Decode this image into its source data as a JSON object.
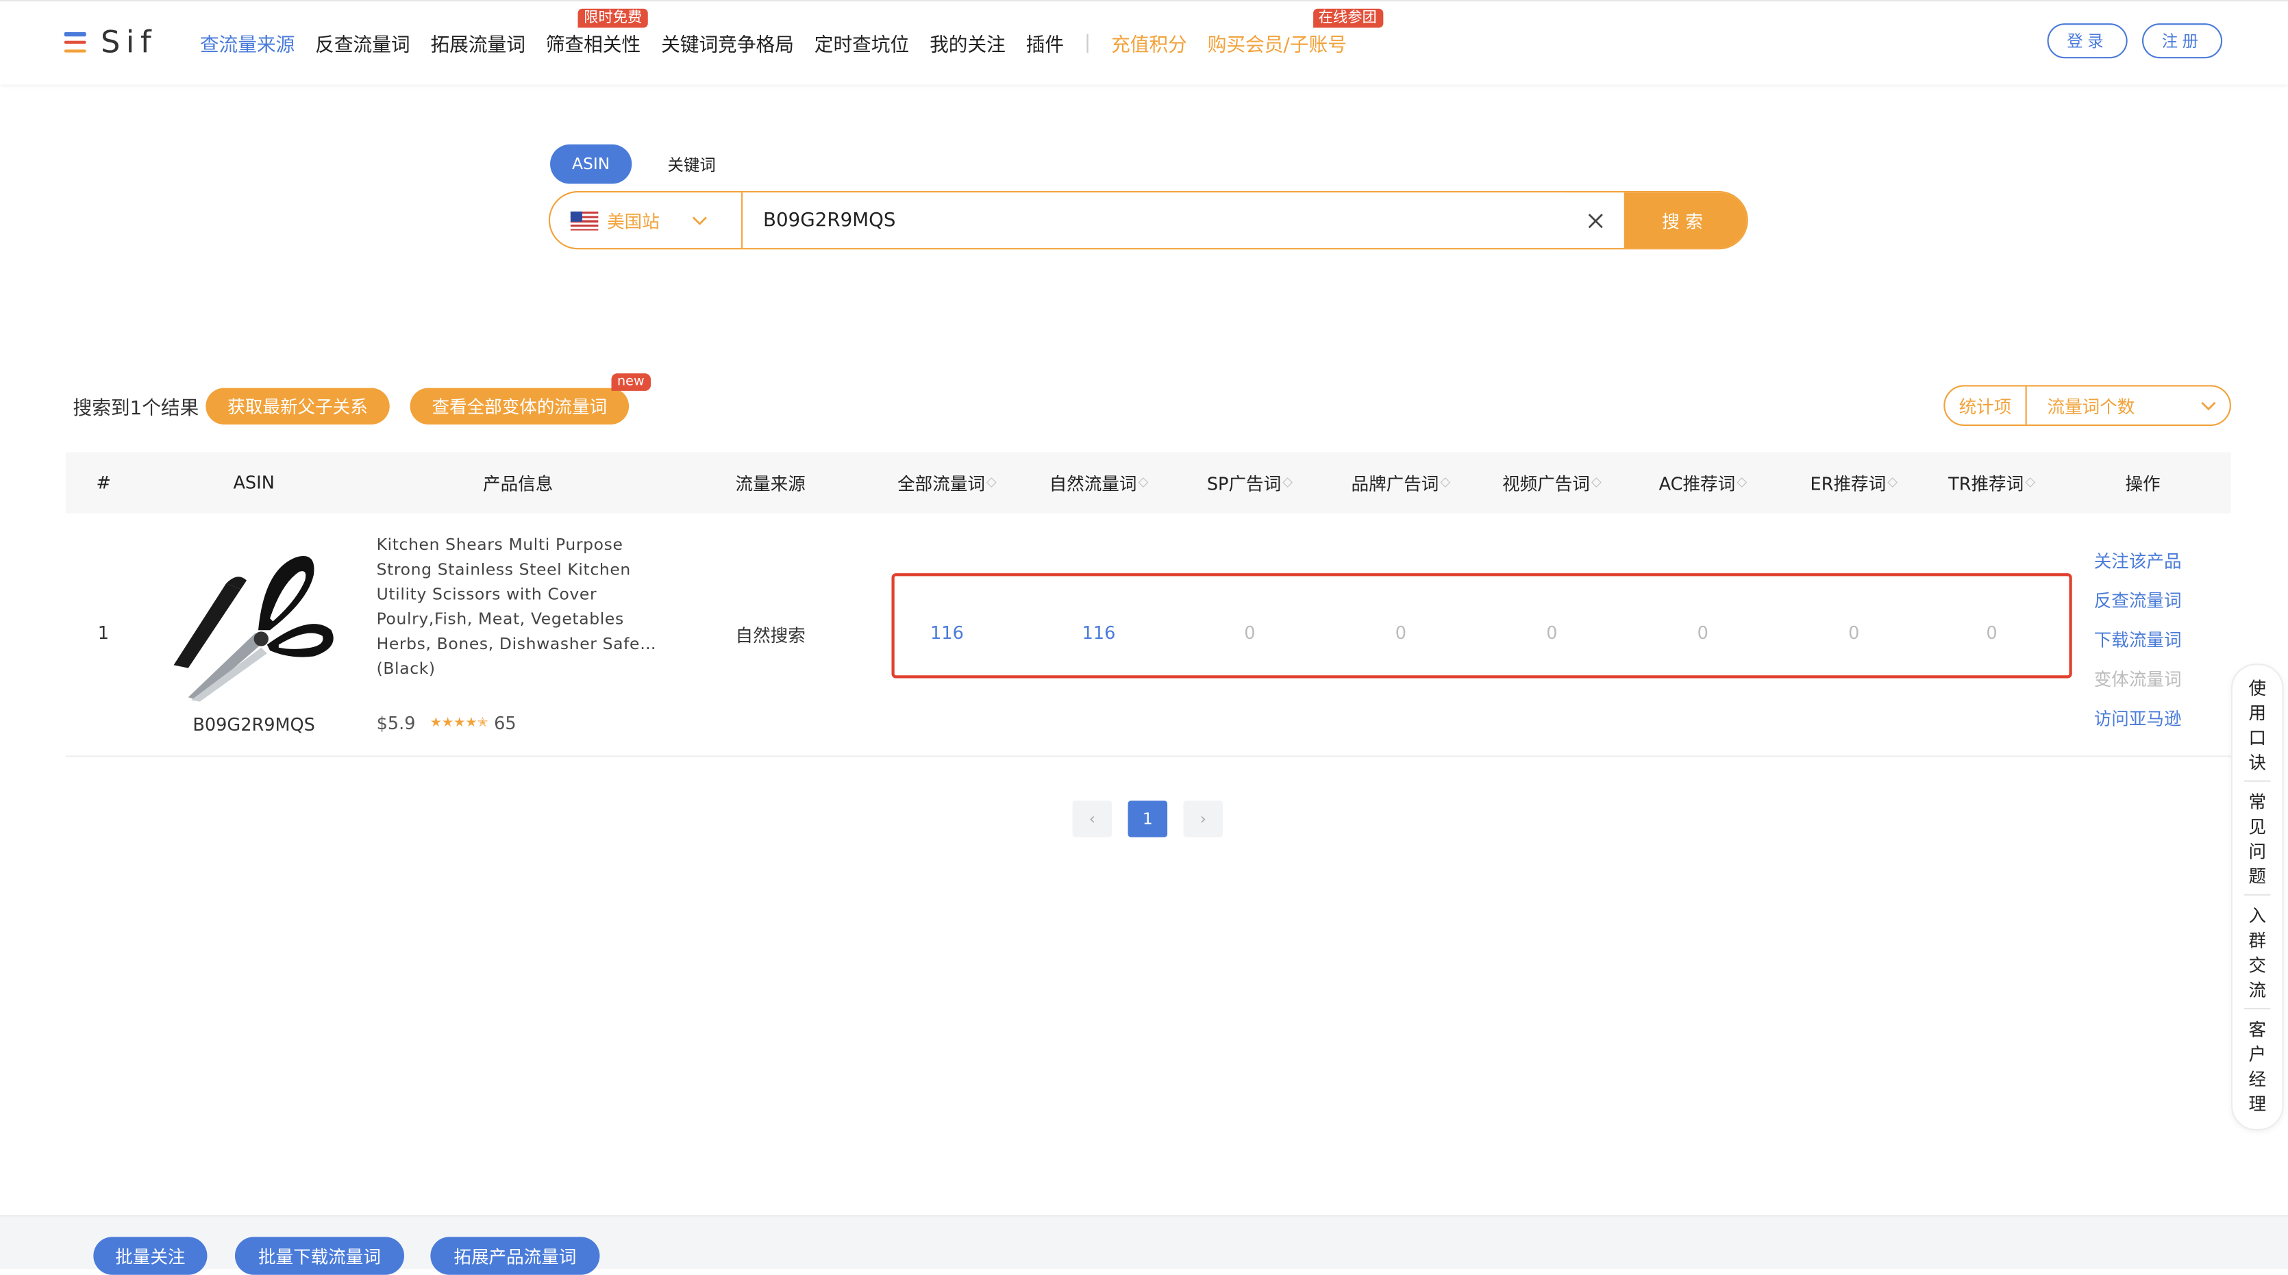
{
  "header": {
    "logo_text": "Sif",
    "logo_colors": [
      "#4a7bd9",
      "#e2503a",
      "#f2a23a"
    ],
    "nav": [
      {
        "label": "查流量来源",
        "active": true
      },
      {
        "label": "反查流量词"
      },
      {
        "label": "拓展流量词"
      },
      {
        "label": "筛查相关性",
        "tag": "限时免费"
      },
      {
        "label": "关键词竞争格局"
      },
      {
        "label": "定时查坑位"
      },
      {
        "label": "我的关注"
      },
      {
        "label": "插件"
      },
      {
        "label": "充值积分",
        "highlight": true
      },
      {
        "label": "购买会员/子账号",
        "highlight": true,
        "tag": "在线参团"
      }
    ],
    "login_label": "登录",
    "register_label": "注册"
  },
  "search": {
    "tabs": [
      "ASIN",
      "关键词"
    ],
    "active_tab": "ASIN",
    "marketplace": "美国站",
    "query": "B09G2R9MQS",
    "button_label": "搜索"
  },
  "results": {
    "summary": "搜索到1个结果",
    "parent_child_button": "获取最新父子关系",
    "variants_button": "查看全部变体的流量词",
    "new_badge": "new",
    "stat_label": "统计项",
    "stat_value": "流量词个数"
  },
  "table": {
    "columns": [
      "#",
      "ASIN",
      "产品信息",
      "流量来源",
      "全部流量词",
      "自然流量词",
      "SP广告词",
      "品牌广告词",
      "视频广告词",
      "AC推荐词",
      "ER推荐词",
      "TR推荐词",
      "操作"
    ],
    "rows": [
      {
        "index": "1",
        "asin": "B09G2R9MQS",
        "title": "Kitchen Shears Multi Purpose Strong Stainless Steel Kitchen Utility Scissors with Cover Poulry,Fish, Meat, Vegetables Herbs, Bones, Dishwasher Safe… (Black)",
        "price": "$5.9",
        "rating": 4.5,
        "reviews": "65",
        "source": "自然搜索",
        "all_words": "116",
        "organic_words": "116",
        "sp_words": "0",
        "brand_words": "0",
        "video_words": "0",
        "ac_words": "0",
        "er_words": "0",
        "tr_words": "0",
        "actions": [
          "关注该产品",
          "反查流量词",
          "下载流量词",
          "变体流量词",
          "访问亚马逊"
        ]
      }
    ]
  },
  "pagination": {
    "prev": "‹",
    "current": "1",
    "next": "›"
  },
  "side_help": [
    "使用口诀",
    "常见问题",
    "入群交流",
    "客户经理"
  ],
  "bottom_actions": [
    "批量关注",
    "批量下载流量词",
    "拓展产品流量词"
  ],
  "colors": {
    "primary": "#4a7bd9",
    "accent": "#f2a23a",
    "alert": "#e2402e"
  }
}
